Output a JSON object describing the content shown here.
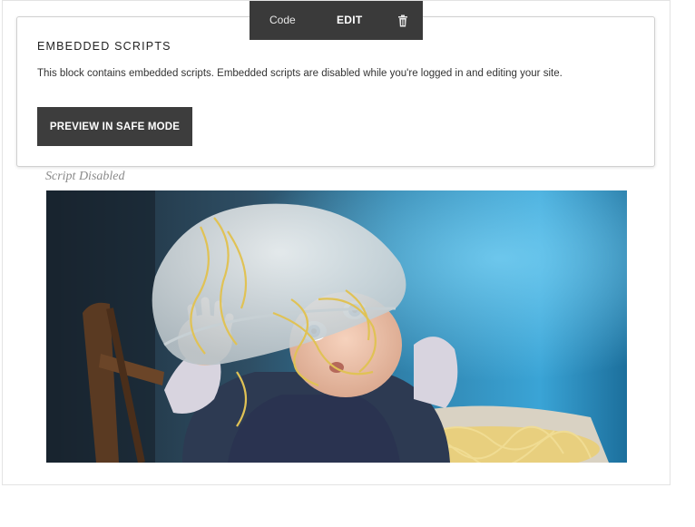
{
  "toolbar": {
    "code_label": "Code",
    "edit_label": "EDIT",
    "delete_icon": "trash-icon"
  },
  "embedded_scripts": {
    "title": "EMBEDDED SCRIPTS",
    "description": "This block contains embedded scripts. Embedded scripts are disabled while you're logged in and editing your site.",
    "preview_button_label": "PREVIEW IN SAFE MODE"
  },
  "script_disabled_caption": "Script Disabled",
  "colors": {
    "toolbar_bg": "#3a3a3a",
    "button_bg": "#3d3d3d",
    "caption_gray": "#8a8a8a"
  }
}
